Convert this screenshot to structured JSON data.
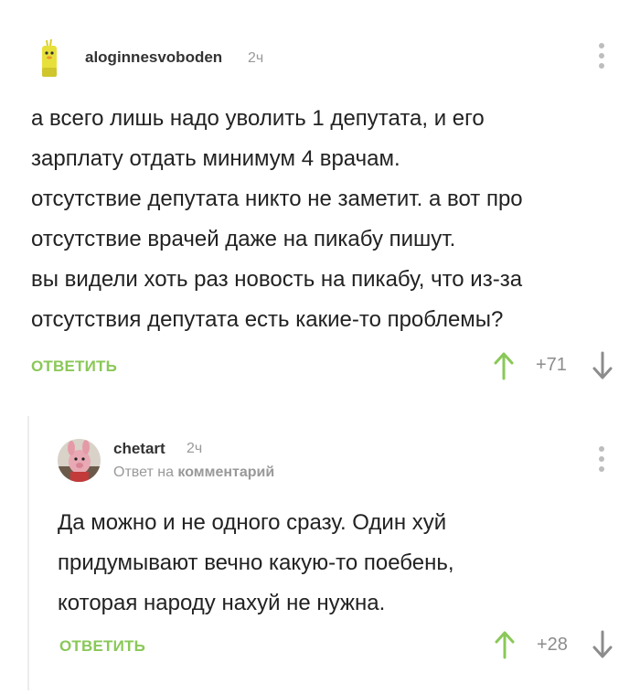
{
  "comments": [
    {
      "username": "aloginnesvoboden",
      "time": "2ч",
      "lines": [
        "а всего лишь надо уволить 1 депутата, и его",
        "зарплату отдать минимум 4 врачам.",
        "отсутствие депутата никто не заметит. а вот про",
        "отсутствие врачей даже на пикабу пишут.",
        "вы видели хоть раз новость на пикабу, что из-за",
        "отсутствия депутата есть какие-то проблемы?"
      ],
      "reply_label": "ОТВЕТИТЬ",
      "rating": "+71",
      "avatar_icon": "duck-avatar-icon"
    },
    {
      "username": "chetart",
      "time": "2ч",
      "reply_prefix": "Ответ на",
      "reply_target": "комментарий",
      "lines": [
        "Да можно и не одного сразу. Один хуй",
        "придумывают вечно какую-то поебень,",
        "которая народу нахуй не нужна."
      ],
      "reply_label": "ОТВЕТИТЬ",
      "rating": "+28",
      "avatar_icon": "pig-avatar-icon"
    }
  ],
  "colors": {
    "accent_green": "#8ac858",
    "muted_gray": "#999999",
    "thread_line": "#ececec"
  }
}
